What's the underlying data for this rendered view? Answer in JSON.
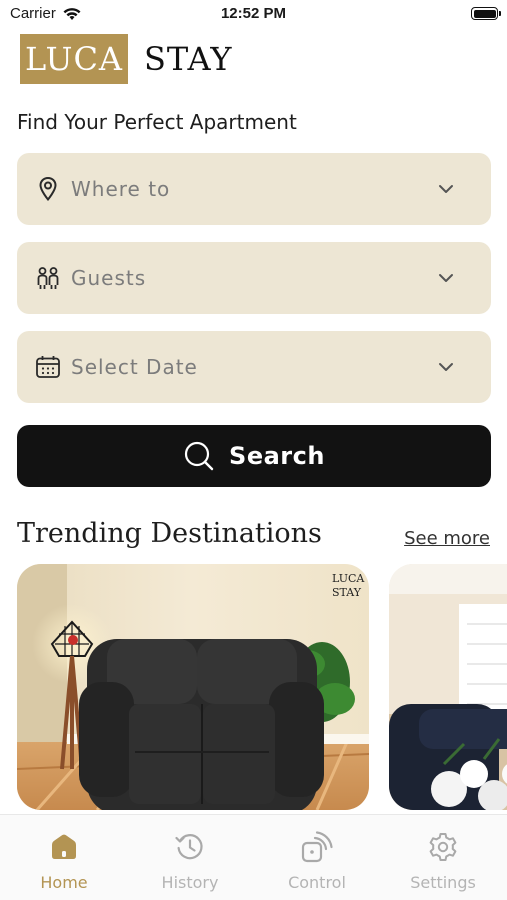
{
  "status_bar": {
    "carrier": "Carrier",
    "time": "12:52 PM"
  },
  "logo": {
    "box_text": "LUCA",
    "text": "STAY"
  },
  "subtitle": "Find Your Perfect Apartment",
  "fields": {
    "where": {
      "label": "Where to",
      "icon": "location-pin-icon"
    },
    "guests": {
      "label": "Guests",
      "icon": "guests-icon"
    },
    "date": {
      "label": "Select Date",
      "icon": "calendar-icon"
    }
  },
  "search_button": {
    "label": "Search",
    "icon": "search-icon"
  },
  "trending": {
    "title": "Trending Destinations",
    "see_more": "See more"
  },
  "cards": [
    {
      "watermark_1": "LUCA",
      "watermark_2": "STAY"
    }
  ],
  "tabs": [
    {
      "label": "Home",
      "icon": "home-icon",
      "active": true
    },
    {
      "label": "History",
      "icon": "history-icon",
      "active": false
    },
    {
      "label": "Control",
      "icon": "control-icon",
      "active": false
    },
    {
      "label": "Settings",
      "icon": "gear-icon",
      "active": false
    }
  ],
  "colors": {
    "accent": "#b39453",
    "field_bg": "#ede6d4",
    "button_bg": "#121212",
    "inactive": "#b4b4b4"
  }
}
